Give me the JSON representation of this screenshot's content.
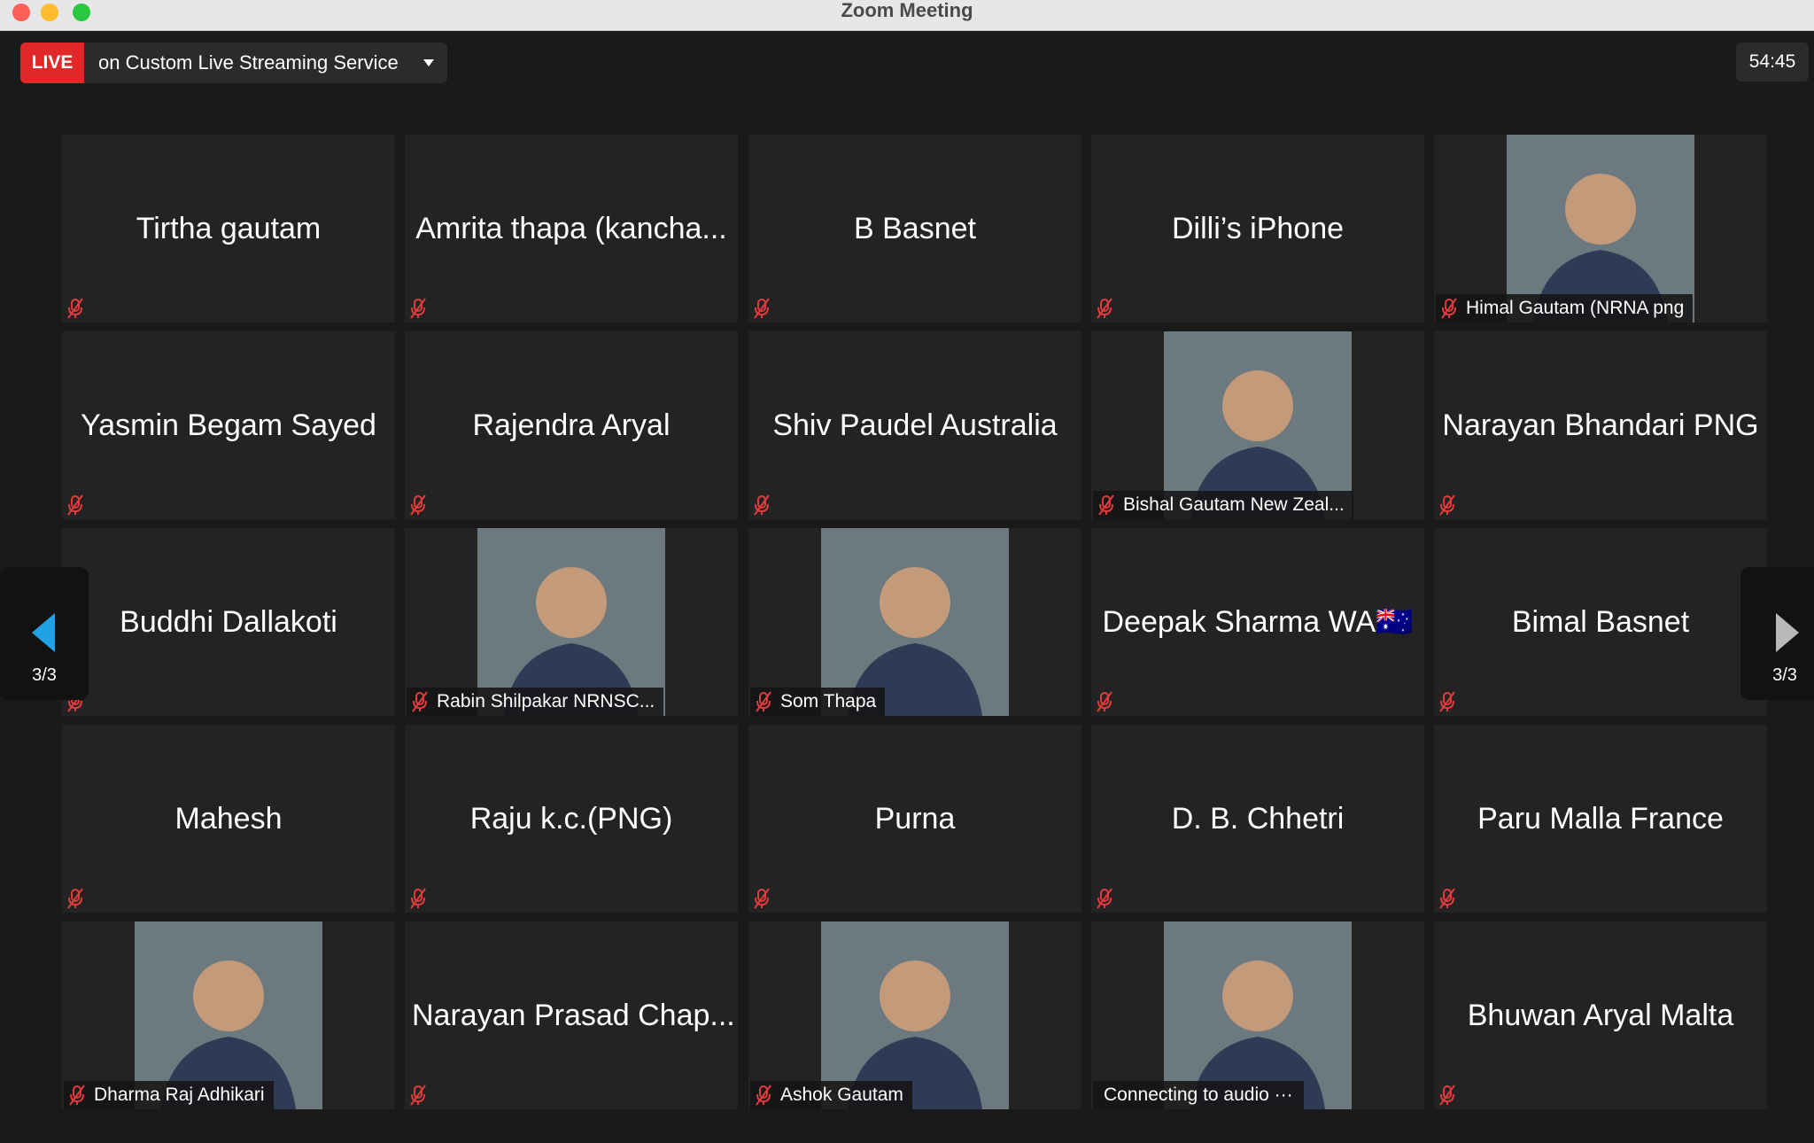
{
  "window": {
    "title": "Zoom Meeting"
  },
  "live": {
    "badge": "LIVE",
    "service": "on Custom Live Streaming Service"
  },
  "timer": "54:45",
  "pager": {
    "left_count": "3/3",
    "right_count": "3/3"
  },
  "colors": {
    "live_red": "#e02828",
    "mic_muted": "#e23b3b",
    "pager_accent": "#1fa3e6"
  },
  "participants": [
    {
      "name": "Tirtha gautam",
      "video": false,
      "muted": true
    },
    {
      "name": "Amrita thapa (kancha...",
      "video": false,
      "muted": true
    },
    {
      "name": "B Basnet",
      "video": false,
      "muted": true
    },
    {
      "name": "Dilli’s iPhone",
      "video": false,
      "muted": true
    },
    {
      "name": "Himal Gautam (NRNA png",
      "video": true,
      "muted": true
    },
    {
      "name": "Yasmin Begam Sayed",
      "video": false,
      "muted": true
    },
    {
      "name": "Rajendra Aryal",
      "video": false,
      "muted": true
    },
    {
      "name": "Shiv Paudel Australia",
      "video": false,
      "muted": true
    },
    {
      "name": "Bishal Gautam New Zeal...",
      "video": true,
      "muted": true
    },
    {
      "name": "Narayan Bhandari PNG",
      "video": false,
      "muted": true
    },
    {
      "name": "Buddhi Dallakoti",
      "video": false,
      "muted": true
    },
    {
      "name": "Rabin Shilpakar NRNSC...",
      "video": true,
      "muted": true
    },
    {
      "name": "Som Thapa",
      "video": true,
      "muted": true
    },
    {
      "name": "Deepak Sharma WA🇦🇺",
      "video": false,
      "muted": true
    },
    {
      "name": "Bimal Basnet",
      "video": false,
      "muted": true
    },
    {
      "name": "Mahesh",
      "video": false,
      "muted": true
    },
    {
      "name": "Raju k.c.(PNG)",
      "video": false,
      "muted": true
    },
    {
      "name": "Purna",
      "video": false,
      "muted": true
    },
    {
      "name": "D. B. Chhetri",
      "video": false,
      "muted": true
    },
    {
      "name": "Paru Malla France",
      "video": false,
      "muted": true
    },
    {
      "name": "Dharma Raj Adhikari",
      "video": true,
      "muted": true
    },
    {
      "name": "Narayan Prasad Chap...",
      "video": false,
      "muted": true
    },
    {
      "name": "Ashok Gautam",
      "video": true,
      "muted": true
    },
    {
      "name": "Connecting to audio ···",
      "video": true,
      "muted": false
    },
    {
      "name": "Bhuwan Aryal Malta",
      "video": false,
      "muted": true
    }
  ]
}
